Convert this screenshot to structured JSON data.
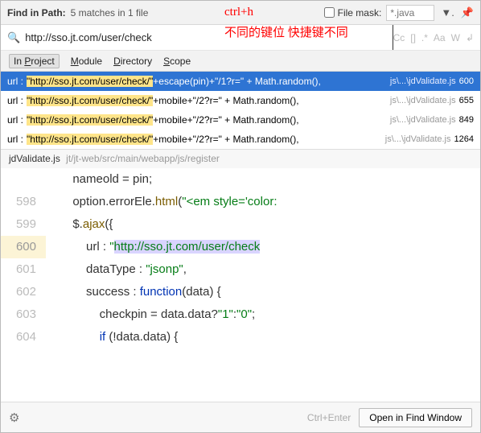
{
  "header": {
    "title": "Find in Path:",
    "subtitle": "5 matches in 1 file",
    "file_mask_label": "File mask:",
    "file_mask_placeholder": "*.java"
  },
  "annotations": {
    "line1": "ctrl+h",
    "line2": "不同的键位  快捷键不同"
  },
  "search": {
    "value": "http://sso.jt.com/user/check",
    "opts": [
      "Cc",
      "[]",
      ".*",
      "Aa",
      "W",
      "↲"
    ]
  },
  "scope": {
    "items": [
      {
        "html": "In <u>P</u>roject",
        "active": true
      },
      {
        "html": "<u>M</u>odule"
      },
      {
        "html": "<u>D</u>irectory"
      },
      {
        "html": "<u>S</u>cope"
      }
    ]
  },
  "results": [
    {
      "label": "url :",
      "hl": "\"http://sso.jt.com/user/check/\"",
      "rest": "+escape(pin)+\"/1?r=\" + Math.random(),",
      "file": "js\\...\\jdValidate.js",
      "line": "600",
      "selected": true
    },
    {
      "label": "url :",
      "hl": "\"http://sso.jt.com/user/check/\"",
      "rest": "+mobile+\"/2?r=\" + Math.random(),",
      "file": "js\\...\\jdValidate.js",
      "line": "655"
    },
    {
      "label": "url :",
      "hl": "\"http://sso.jt.com/user/check/\"",
      "rest": "+mobile+\"/2?r=\" + Math.random(),",
      "file": "js\\...\\jdValidate.js",
      "line": "849"
    },
    {
      "label": "url :",
      "hl": "\"http://sso.jt.com/user/check/\"",
      "rest": "+mobile+\"/2?r=\" + Math.random(),",
      "file": "js\\...\\jdValidate.js",
      "line": "1264"
    }
  ],
  "preview": {
    "file_name": "jdValidate.js",
    "file_path": "jt/jt-web/src/main/webapp/js/register",
    "lines": [
      {
        "no": "",
        "html": "        nameold = pin;"
      },
      {
        "no": "598",
        "html": "        option.errorEle.<span class='fn'>html</span>(<span class='str'>\"&lt;em style='color:</span>"
      },
      {
        "no": "599",
        "html": "        $.<span class='fn'>ajax</span>({"
      },
      {
        "no": "600",
        "html": "            url : <span class='str'>\"</span><span class='codehl'>http://sso.jt.com/user/check</span>",
        "active": true
      },
      {
        "no": "601",
        "html": "            dataType : <span class='str'>\"jsonp\"</span>,"
      },
      {
        "no": "602",
        "html": "            success : <span class='kw'>function</span>(data) {"
      },
      {
        "no": "603",
        "html": "                checkpin = data.data?<span class='str'>\"1\"</span>:<span class='str'>\"0\"</span>;"
      },
      {
        "no": "604",
        "html": "                <span class='kw'>if</span> (!data.data) {"
      }
    ]
  },
  "footer": {
    "hint": "Ctrl+Enter",
    "open_btn": "Open in Find Window"
  }
}
